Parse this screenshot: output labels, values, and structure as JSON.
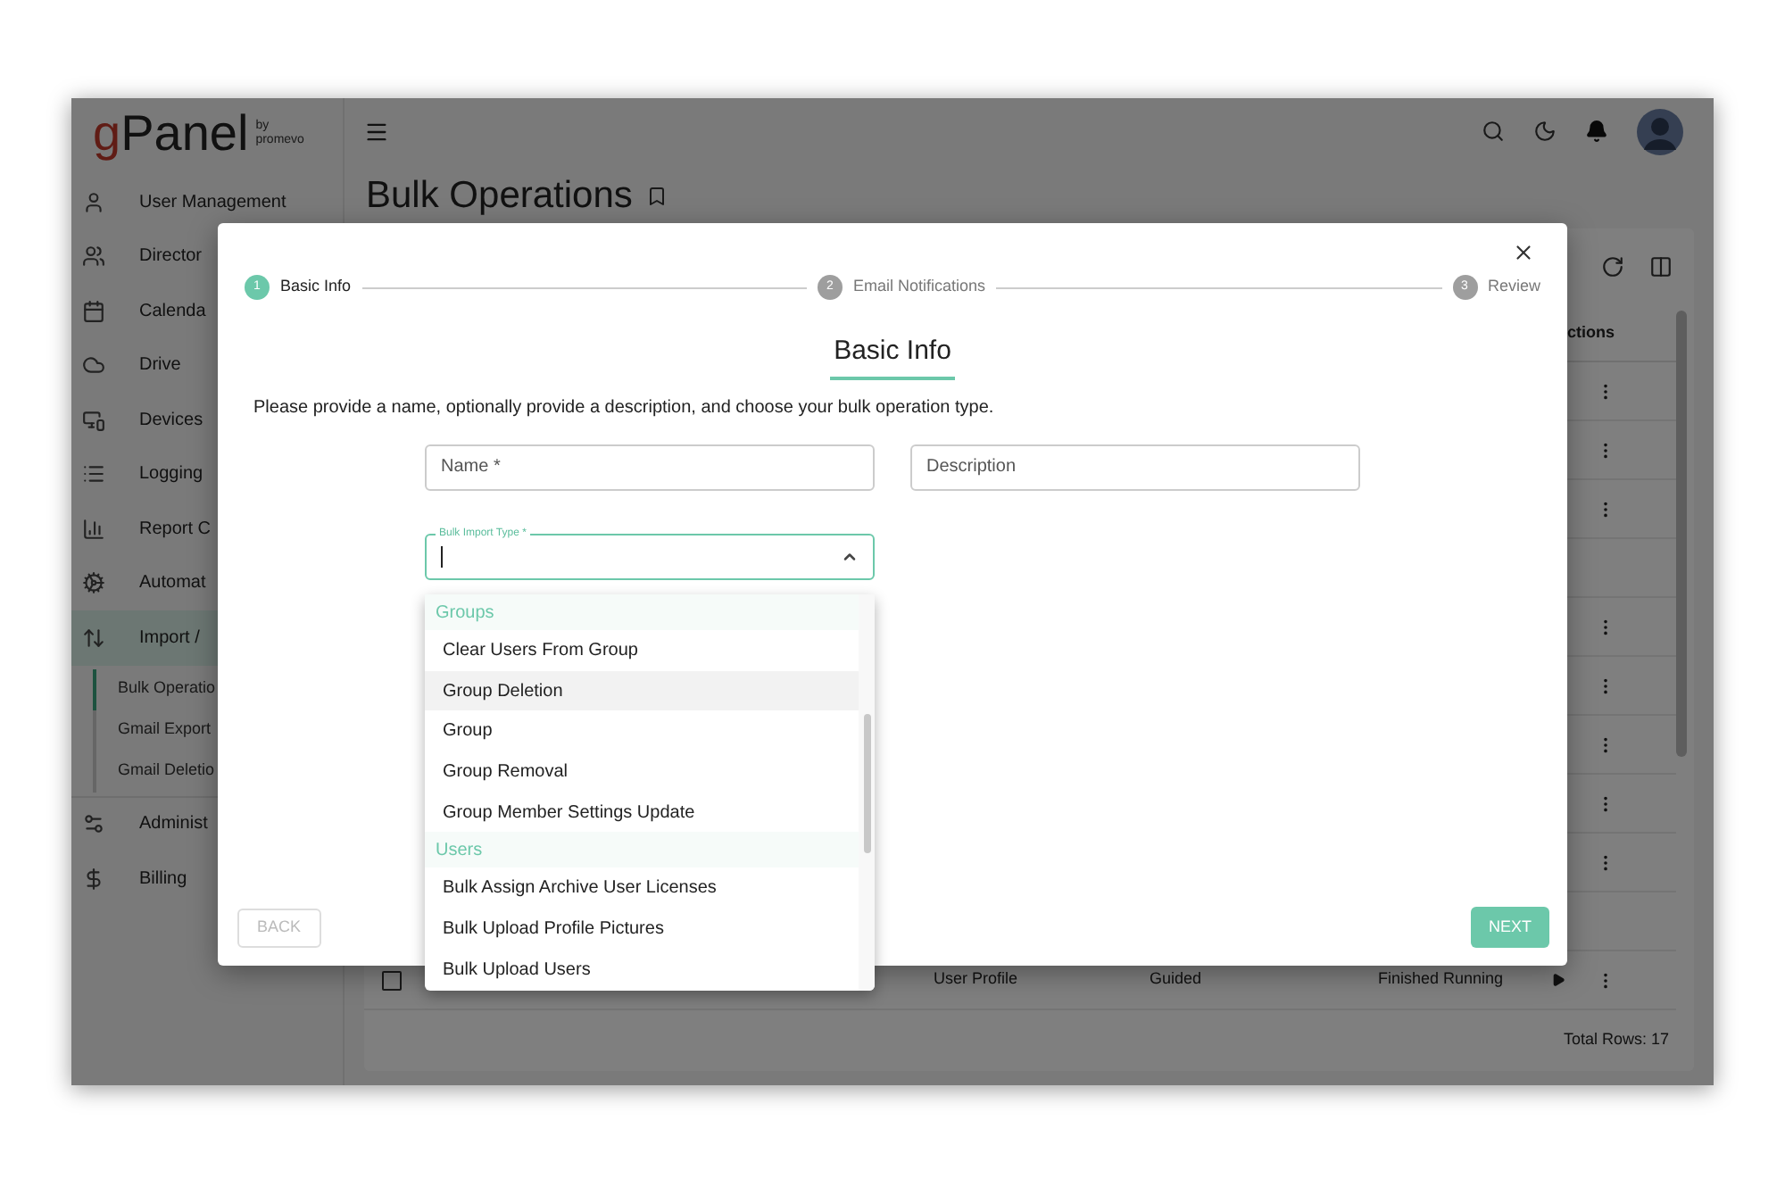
{
  "sidebar": {
    "logo": {
      "mark": "g",
      "word": "Panel",
      "by": "by",
      "company": "promevo"
    },
    "items": [
      {
        "label": "User Management",
        "selected": false
      },
      {
        "label": "Director",
        "selected": false
      },
      {
        "label": "Calenda",
        "selected": false
      },
      {
        "label": "Drive",
        "selected": false
      },
      {
        "label": "Devices",
        "selected": false
      },
      {
        "label": "Logging",
        "selected": false
      },
      {
        "label": "Report C",
        "selected": false
      },
      {
        "label": "Automat",
        "selected": false
      },
      {
        "label": "Import /",
        "selected": true,
        "children": [
          {
            "label": "Bulk Operatio",
            "selected": true
          },
          {
            "label": "Gmail Export",
            "selected": false
          },
          {
            "label": "Gmail Deletio",
            "selected": false
          }
        ]
      },
      {
        "label": "Administ",
        "selected": false
      },
      {
        "label": "Billing",
        "selected": false
      }
    ]
  },
  "page": {
    "title": "Bulk Operations"
  },
  "table": {
    "columns": [
      "ctions"
    ],
    "rows": [
      {
        "menu": true
      },
      {
        "menu": true
      },
      {
        "menu": true
      },
      {
        "menu": false
      },
      {
        "menu": true
      },
      {
        "menu": true
      },
      {
        "menu": true
      },
      {
        "menu": true
      },
      {
        "menu": true
      },
      {
        "menu": false
      },
      {
        "menu": true,
        "checked": false,
        "cells": [
          "User Profile",
          "Guided",
          "Finished Running"
        ]
      }
    ],
    "total": "Total Rows: 17"
  },
  "dialog": {
    "steps": [
      {
        "number": "1",
        "label": "Basic Info",
        "selected": true
      },
      {
        "number": "2",
        "label": "Email Notifications",
        "selected": false
      },
      {
        "number": "3",
        "label": "Review",
        "selected": false
      }
    ],
    "heading": "Basic Info",
    "instructions": "Please provide a name, optionally provide a description, and choose your bulk operation type.",
    "fields": [
      {
        "placeholder": "Name *"
      },
      {
        "placeholder": "Description"
      }
    ],
    "select": {
      "label": "Bulk Import Type *",
      "expanded": true,
      "options": [
        {
          "kind": "header",
          "label": "Groups"
        },
        {
          "kind": "option",
          "label": "Clear Users From Group",
          "highlighted": false
        },
        {
          "kind": "option",
          "label": "Group Deletion",
          "highlighted": true
        },
        {
          "kind": "option",
          "label": "Group",
          "highlighted": false
        },
        {
          "kind": "option",
          "label": "Group Removal",
          "highlighted": false
        },
        {
          "kind": "option",
          "label": "Group Member Settings Update",
          "highlighted": false
        },
        {
          "kind": "header",
          "label": "Users"
        },
        {
          "kind": "option",
          "label": "Bulk Assign Archive User Licenses",
          "highlighted": false
        },
        {
          "kind": "option",
          "label": "Bulk Upload Profile Pictures",
          "highlighted": false
        },
        {
          "kind": "option",
          "label": "Bulk Upload Users",
          "highlighted": false
        }
      ]
    },
    "back": {
      "label": "BACK",
      "disabled": true
    },
    "next": {
      "label": "NEXT",
      "disabled": false
    }
  }
}
